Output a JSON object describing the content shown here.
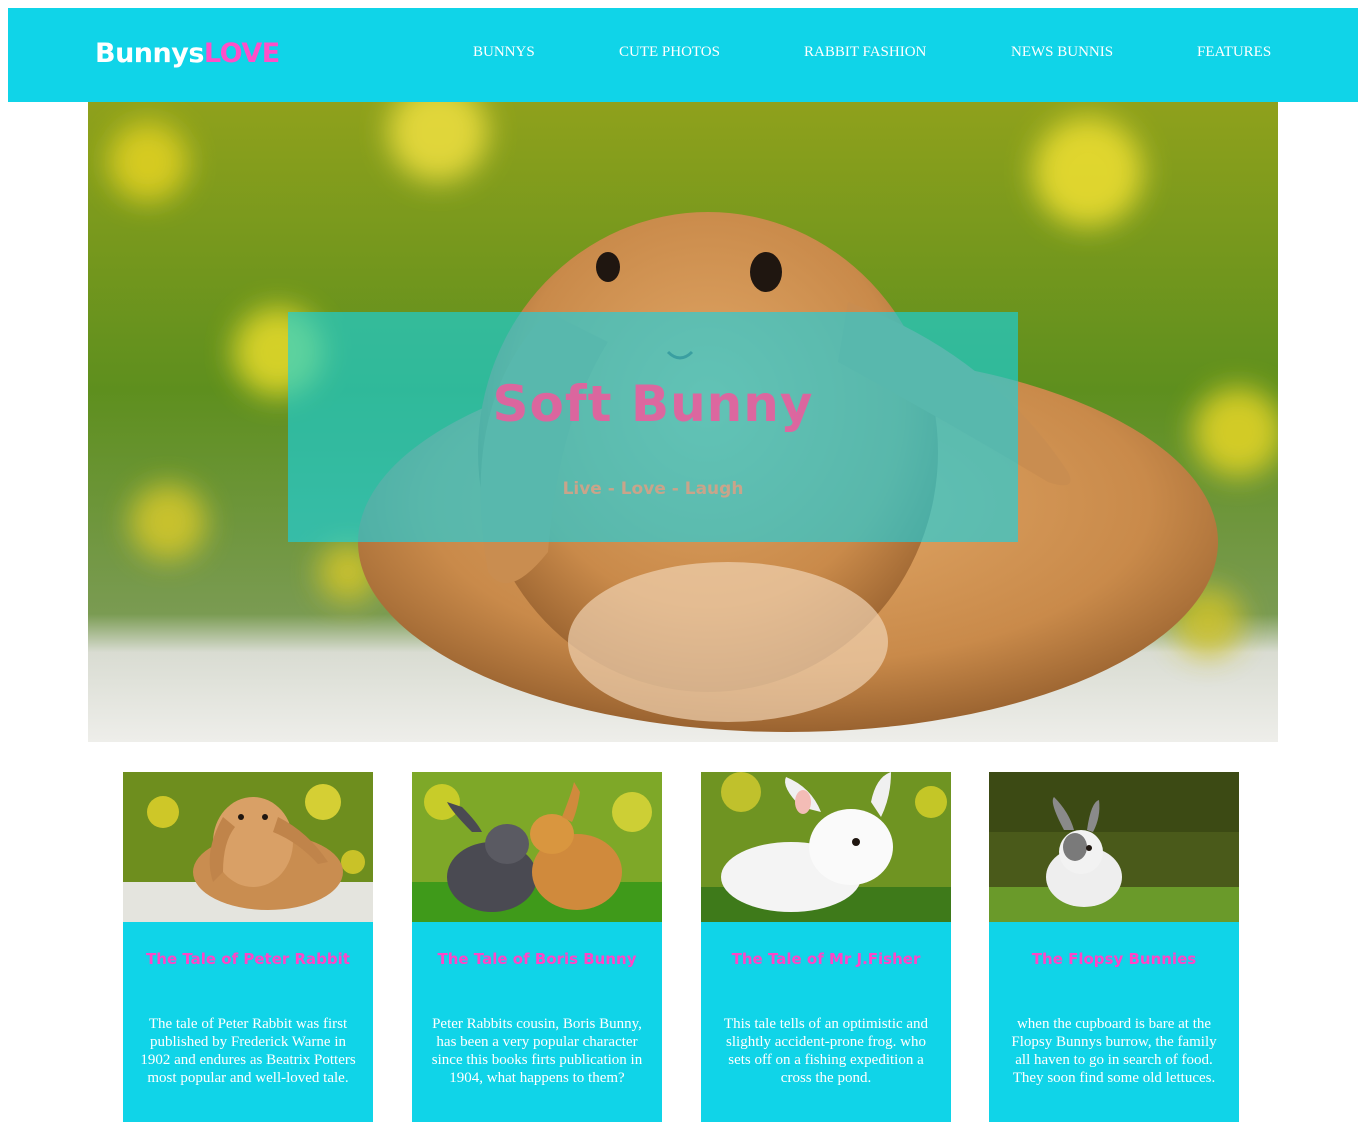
{
  "brand": {
    "part1": "Bunnys",
    "part2": "LOVE",
    "color_primary": "#ffffff",
    "color_accent": "#ff4fc8"
  },
  "theme": {
    "header_bg": "#10d4e8",
    "card_bg": "#10d4e8",
    "title_pink": "#ff45c6"
  },
  "nav": {
    "items": [
      {
        "label": "BUNNYS"
      },
      {
        "label": "CUTE PHOTOS"
      },
      {
        "label": "RABBIT FASHION"
      },
      {
        "label": "NEWS BUNNIS"
      },
      {
        "label": "FEATURES"
      }
    ]
  },
  "hero": {
    "title": "Soft Bunny",
    "subtitle": "Live - Love - Laugh"
  },
  "cards": [
    {
      "title": "The Tale of Peter Rabbit",
      "text": "The tale of Peter Rabbit was first published by Frederick Warne in 1902 and endures as Beatrix Potters most popular and well-loved tale."
    },
    {
      "title": "The Tale of Boris Bunny",
      "text": "Peter Rabbits cousin, Boris Bunny, has been a very popular character since this books firts publication in 1904, what happens to them?"
    },
    {
      "title": "The Tale of Mr J.Fisher",
      "text": "This tale tells of an optimistic and slightly accident-prone frog. who sets off on a fishing expedition a cross the pond."
    },
    {
      "title": "The Flopsy Bunnies",
      "text": "when the cupboard is bare at the Flopsy Bunnys burrow, the family all haven to go in search of food. They soon find some old lettuces."
    }
  ]
}
